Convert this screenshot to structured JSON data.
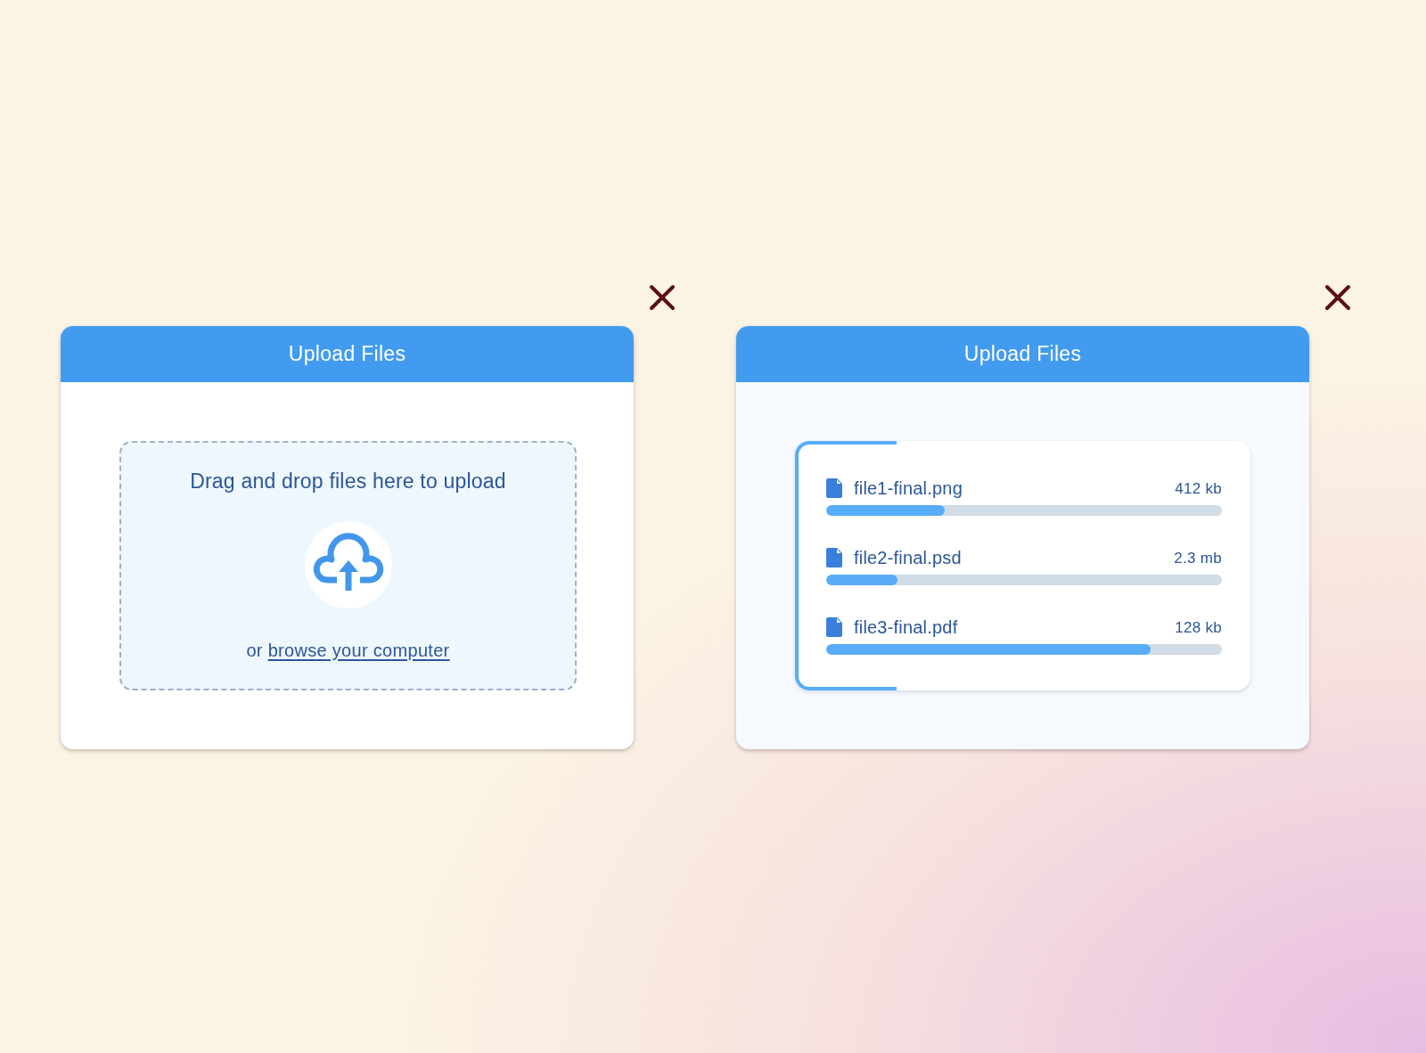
{
  "cards": [
    {
      "kind": "dropzone",
      "title": "Upload Files",
      "dropzone": {
        "prompt": "Drag and drop files here to upload",
        "browse_prefix": "or",
        "browse_link": "browse your computer"
      }
    },
    {
      "kind": "progress",
      "title": "Upload Files",
      "files": [
        {
          "name": "file1-final.png",
          "size": "412 kb",
          "level": 0.3
        },
        {
          "name": "file2-final.psd",
          "size": "2.3 mb",
          "level": 0.18
        },
        {
          "name": "file3-final.pdf",
          "size": "128 kb",
          "level": 0.82
        }
      ]
    }
  ]
}
